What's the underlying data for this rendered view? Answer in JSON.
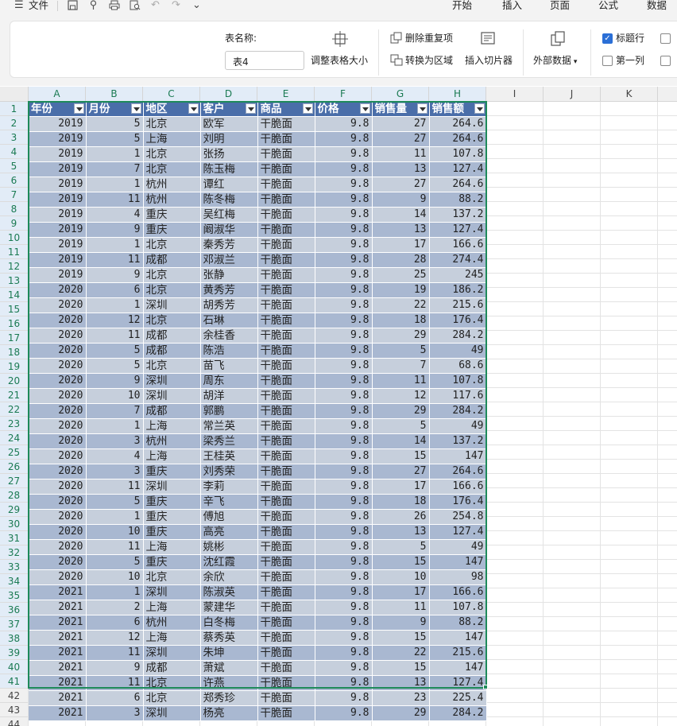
{
  "menubar": {
    "file_label": "文件",
    "tabs": [
      "开始",
      "插入",
      "页面",
      "公式",
      "数据"
    ]
  },
  "ribbon": {
    "table_name_label": "表名称:",
    "table_name_value": "表4",
    "resize_table": "调整表格大小",
    "remove_duplicates": "删除重复项",
    "convert_to_range": "转换为区域",
    "insert_slicer": "插入切片器",
    "external_data": "外部数据",
    "header_row": "标题行",
    "first_column": "第一列",
    "header_row_checked": true,
    "first_column_checked": false
  },
  "sheet": {
    "columns": [
      "A",
      "B",
      "C",
      "D",
      "E",
      "F",
      "G",
      "H",
      "I",
      "J",
      "K"
    ],
    "row_numbers": [
      1,
      2,
      3,
      4,
      5,
      6,
      7,
      8,
      9,
      10,
      11,
      12,
      13,
      14,
      15,
      16,
      17,
      18,
      19,
      20,
      21,
      22,
      23,
      24,
      25,
      26,
      27,
      28,
      29,
      30,
      31,
      32,
      33,
      34,
      35,
      36,
      37,
      38,
      39,
      40,
      41,
      42,
      43,
      44
    ],
    "headers": [
      "年份",
      "月份",
      "地区",
      "客户",
      "商品",
      "价格",
      "销售量",
      "销售额"
    ],
    "rows": [
      [
        "2019",
        "5",
        "北京",
        "欧军",
        "干脆面",
        "9.8",
        "27",
        "264.6"
      ],
      [
        "2019",
        "5",
        "上海",
        "刘明",
        "干脆面",
        "9.8",
        "27",
        "264.6"
      ],
      [
        "2019",
        "1",
        "北京",
        "张扬",
        "干脆面",
        "9.8",
        "11",
        "107.8"
      ],
      [
        "2019",
        "7",
        "北京",
        "陈玉梅",
        "干脆面",
        "9.8",
        "13",
        "127.4"
      ],
      [
        "2019",
        "1",
        "杭州",
        "谭红",
        "干脆面",
        "9.8",
        "27",
        "264.6"
      ],
      [
        "2019",
        "11",
        "杭州",
        "陈冬梅",
        "干脆面",
        "9.8",
        "9",
        "88.2"
      ],
      [
        "2019",
        "4",
        "重庆",
        "吴红梅",
        "干脆面",
        "9.8",
        "14",
        "137.2"
      ],
      [
        "2019",
        "9",
        "重庆",
        "阚淑华",
        "干脆面",
        "9.8",
        "13",
        "127.4"
      ],
      [
        "2019",
        "1",
        "北京",
        "秦秀芳",
        "干脆面",
        "9.8",
        "17",
        "166.6"
      ],
      [
        "2019",
        "11",
        "成都",
        "邓淑兰",
        "干脆面",
        "9.8",
        "28",
        "274.4"
      ],
      [
        "2019",
        "9",
        "北京",
        "张静",
        "干脆面",
        "9.8",
        "25",
        "245"
      ],
      [
        "2020",
        "6",
        "北京",
        "黄秀芳",
        "干脆面",
        "9.8",
        "19",
        "186.2"
      ],
      [
        "2020",
        "1",
        "深圳",
        "胡秀芳",
        "干脆面",
        "9.8",
        "22",
        "215.6"
      ],
      [
        "2020",
        "12",
        "北京",
        "石琳",
        "干脆面",
        "9.8",
        "18",
        "176.4"
      ],
      [
        "2020",
        "11",
        "成都",
        "余桂香",
        "干脆面",
        "9.8",
        "29",
        "284.2"
      ],
      [
        "2020",
        "5",
        "成都",
        "陈浩",
        "干脆面",
        "9.8",
        "5",
        "49"
      ],
      [
        "2020",
        "5",
        "北京",
        "苗飞",
        "干脆面",
        "9.8",
        "7",
        "68.6"
      ],
      [
        "2020",
        "9",
        "深圳",
        "周东",
        "干脆面",
        "9.8",
        "11",
        "107.8"
      ],
      [
        "2020",
        "10",
        "深圳",
        "胡洋",
        "干脆面",
        "9.8",
        "12",
        "117.6"
      ],
      [
        "2020",
        "7",
        "成都",
        "郭鹏",
        "干脆面",
        "9.8",
        "29",
        "284.2"
      ],
      [
        "2020",
        "1",
        "上海",
        "常兰英",
        "干脆面",
        "9.8",
        "5",
        "49"
      ],
      [
        "2020",
        "3",
        "杭州",
        "梁秀兰",
        "干脆面",
        "9.8",
        "14",
        "137.2"
      ],
      [
        "2020",
        "4",
        "上海",
        "王桂英",
        "干脆面",
        "9.8",
        "15",
        "147"
      ],
      [
        "2020",
        "3",
        "重庆",
        "刘秀荣",
        "干脆面",
        "9.8",
        "27",
        "264.6"
      ],
      [
        "2020",
        "11",
        "深圳",
        "李莉",
        "干脆面",
        "9.8",
        "17",
        "166.6"
      ],
      [
        "2020",
        "5",
        "重庆",
        "辛飞",
        "干脆面",
        "9.8",
        "18",
        "176.4"
      ],
      [
        "2020",
        "1",
        "重庆",
        "傅旭",
        "干脆面",
        "9.8",
        "26",
        "254.8"
      ],
      [
        "2020",
        "10",
        "重庆",
        "高亮",
        "干脆面",
        "9.8",
        "13",
        "127.4"
      ],
      [
        "2020",
        "11",
        "上海",
        "姚彬",
        "干脆面",
        "9.8",
        "5",
        "49"
      ],
      [
        "2020",
        "5",
        "重庆",
        "沈红霞",
        "干脆面",
        "9.8",
        "15",
        "147"
      ],
      [
        "2020",
        "10",
        "北京",
        "余欣",
        "干脆面",
        "9.8",
        "10",
        "98"
      ],
      [
        "2021",
        "1",
        "深圳",
        "陈淑英",
        "干脆面",
        "9.8",
        "17",
        "166.6"
      ],
      [
        "2021",
        "2",
        "上海",
        "蒙建华",
        "干脆面",
        "9.8",
        "11",
        "107.8"
      ],
      [
        "2021",
        "6",
        "杭州",
        "白冬梅",
        "干脆面",
        "9.8",
        "9",
        "88.2"
      ],
      [
        "2021",
        "12",
        "上海",
        "蔡秀英",
        "干脆面",
        "9.8",
        "15",
        "147"
      ],
      [
        "2021",
        "11",
        "深圳",
        "朱坤",
        "干脆面",
        "9.8",
        "22",
        "215.6"
      ],
      [
        "2021",
        "9",
        "成都",
        "萧斌",
        "干脆面",
        "9.8",
        "15",
        "147"
      ],
      [
        "2021",
        "11",
        "北京",
        "许燕",
        "干脆面",
        "9.8",
        "13",
        "127.4"
      ],
      [
        "2021",
        "6",
        "北京",
        "郑秀珍",
        "干脆面",
        "9.8",
        "23",
        "225.4"
      ],
      [
        "2021",
        "3",
        "深圳",
        "杨亮",
        "干脆面",
        "9.8",
        "29",
        "284.2"
      ]
    ]
  },
  "colors": {
    "table_header": "#4a6ea9",
    "row_light": "#c6cfdc",
    "row_dark": "#a9b8d1",
    "table_border": "#1e8a5a"
  }
}
